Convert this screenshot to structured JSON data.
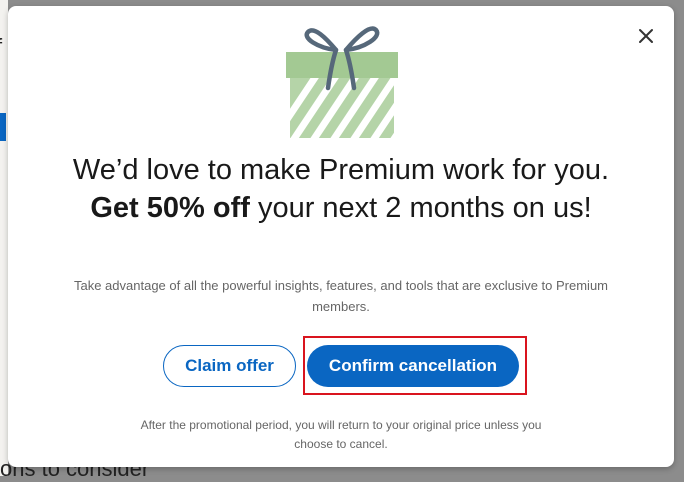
{
  "background": {
    "title_fragment": "f",
    "bottom_fragment": "ons to consider"
  },
  "modal": {
    "close_icon": "close-icon",
    "gift_icon": "gift-icon",
    "headline": {
      "before": "We’d love to make Premium work for you. ",
      "bold": "Get 50% off",
      "after": " your next 2 months on us!"
    },
    "subtext": "Take advantage of all the powerful insights, features, and tools that are exclusive to Premium members.",
    "claim_label": "Claim offer",
    "confirm_label": "Confirm cancellation",
    "footnote": "After the promotional period, you will return to your original price unless you choose to cancel."
  },
  "colors": {
    "brand_blue": "#0a66c2",
    "highlight_red": "#d9141e",
    "gift_green": "#b5d4a8",
    "gift_lid": "#a3c993",
    "ribbon": "#56687a"
  }
}
